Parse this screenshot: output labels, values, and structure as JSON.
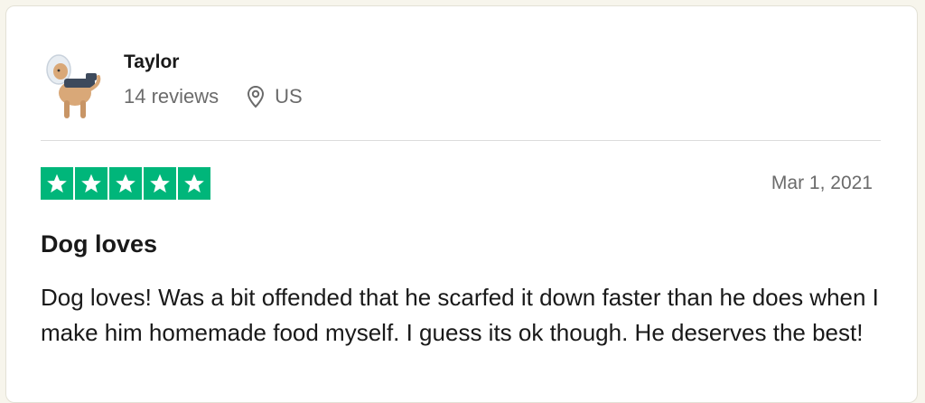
{
  "reviewer": {
    "name": "Taylor",
    "reviews_count": "14 reviews",
    "country": "US",
    "avatar_icon": "dog-avatar-icon",
    "location_icon": "location-pin-icon"
  },
  "review": {
    "rating": 5,
    "rating_max": 5,
    "date": "Mar 1, 2021",
    "title": "Dog loves",
    "text": "Dog loves! Was a bit offended that he scarfed it down faster than he does when I make him homemade food myself. I guess its ok though. He deserves the best!"
  },
  "colors": {
    "star_fill": "#00b67a",
    "text_primary": "#191919",
    "text_secondary": "#6b6b6b"
  }
}
